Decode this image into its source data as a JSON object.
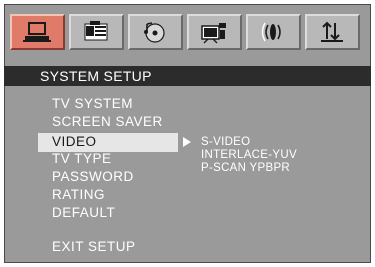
{
  "tabs": [
    {
      "icon": "system-icon",
      "active": true
    },
    {
      "icon": "language-icon",
      "active": false
    },
    {
      "icon": "audio-disc-icon",
      "active": false
    },
    {
      "icon": "video-icon",
      "active": false
    },
    {
      "icon": "speaker-icon",
      "active": false
    },
    {
      "icon": "preference-icon",
      "active": false
    }
  ],
  "header": {
    "title": "SYSTEM SETUP"
  },
  "menu": {
    "items": [
      "TV SYSTEM",
      "SCREEN SAVER",
      "VIDEO",
      "TV TYPE",
      "PASSWORD",
      "RATING",
      "DEFAULT"
    ],
    "selected_index": 2,
    "exit_label": "EXIT SETUP"
  },
  "submenu": {
    "items": [
      "S-VIDEO",
      "INTERLACE-YUV",
      "P-SCAN YPBPR"
    ]
  },
  "colors": {
    "panel": "#9a9a9a",
    "active_tab": "#e07b6a",
    "header_bar": "#2c2c2c",
    "highlight": "#e6e6e6"
  }
}
